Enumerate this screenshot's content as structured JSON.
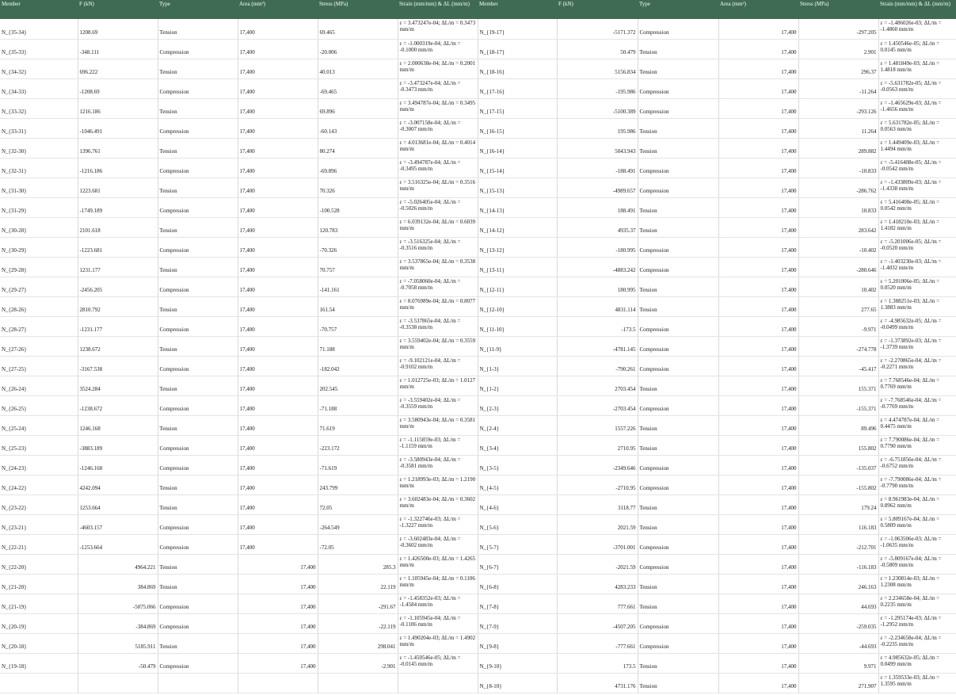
{
  "headers": [
    "Member",
    "F (kN)",
    "Type",
    "Area (mm²)",
    "Stress (MPa)",
    "Strain (mm/mm) & ΔL (mm/m)",
    "Member",
    "F (kN)",
    "Type",
    "Area (mm²)",
    "Stress (MPa)",
    "Strain (mm/mm) & ΔL (mm/m)"
  ],
  "rows": [
    {
      "left": [
        "N_{35-34}",
        "1208.69",
        "Tension",
        "17,400",
        "69.465",
        "ε = 3.473247e-04; ΔL/m = 0.3473 mm/m"
      ],
      "right": [
        "N_{19-17}",
        "-5171.372",
        "Compression",
        "17,400",
        "-297.205",
        "ε = -1.486026e-03; ΔL/m = -1.4860 mm/m"
      ]
    },
    {
      "left": [
        "N_{35-33}",
        "-348.111",
        "Compression",
        "17,400",
        "-20.006",
        "ε = -1.000319e-04; ΔL/m = -0.1000 mm/m"
      ],
      "right": [
        "N_{18-17}",
        "50.479",
        "Tension",
        "17,400",
        "2.901",
        "ε = 1.450546e-05; ΔL/m = 0.0145 mm/m"
      ]
    },
    {
      "left": [
        "N_{34-32}",
        "696.222",
        "Tension",
        "17,400",
        "40.013",
        "ε = 2.000638e-04; ΔL/m = 0.2001 mm/m"
      ],
      "right": [
        "N_{18-16}",
        "5156.834",
        "Tension",
        "17,400",
        "296.37",
        "ε = 1.481849e-03; ΔL/m = 1.4818 mm/m"
      ]
    },
    {
      "left": [
        "N_{34-33}",
        "-1208.69",
        "Compression",
        "17,400",
        "-69.465",
        "ε = -3.473247e-04; ΔL/m = -0.3473 mm/m"
      ],
      "right": [
        "N_{17-16}",
        "-195.986",
        "Compression",
        "17,400",
        "-11.264",
        "ε = -5.631782e-05; ΔL/m = -0.0563 mm/m"
      ]
    },
    {
      "left": [
        "N_{33-32}",
        "1216.186",
        "Tension",
        "17,400",
        "69.896",
        "ε = 3.494787e-04; ΔL/m = 0.3495 mm/m"
      ],
      "right": [
        "N_{17-15}",
        "-5100.389",
        "Compression",
        "17,400",
        "-293.126",
        "ε = -1.465629e-03; ΔL/m = -1.4656 mm/m"
      ]
    },
    {
      "left": [
        "N_{33-31}",
        "-1046.491",
        "Compression",
        "17,400",
        "-60.143",
        "ε = -3.007158e-04; ΔL/m = -0.3007 mm/m"
      ],
      "right": [
        "N_{16-15}",
        "195.986",
        "Tension",
        "17,400",
        "11.264",
        "ε = 5.631782e-05; ΔL/m = 0.0563 mm/m"
      ]
    },
    {
      "left": [
        "N_{32-30}",
        "1396.761",
        "Tension",
        "17,400",
        "80.274",
        "ε = 4.013681e-04; ΔL/m = 0.4014 mm/m"
      ],
      "right": [
        "N_{16-14}",
        "5043.943",
        "Tension",
        "17,400",
        "289.882",
        "ε = 1.449409e-03; ΔL/m = 1.4494 mm/m"
      ]
    },
    {
      "left": [
        "N_{32-31}",
        "-1216.186",
        "Compression",
        "17,400",
        "-69.896",
        "ε = -3.494787e-04; ΔL/m = -0.3495 mm/m"
      ],
      "right": [
        "N_{15-14}",
        "-188.491",
        "Compression",
        "17,400",
        "-10.833",
        "ε = -5.416408e-05; ΔL/m = -0.0542 mm/m"
      ]
    },
    {
      "left": [
        "N_{31-30}",
        "1223.681",
        "Tension",
        "17,400",
        "70.326",
        "ε = 3.516325e-04; ΔL/m = 0.3516 mm/m"
      ],
      "right": [
        "N_{15-13}",
        "-4989.657",
        "Compression",
        "17,400",
        "-286.762",
        "ε = -1.433809e-03; ΔL/m = -1.4338 mm/m"
      ]
    },
    {
      "left": [
        "N_{31-29}",
        "-1749.189",
        "Compression",
        "17,400",
        "-100.528",
        "ε = -5.026405e-04; ΔL/m = -0.5026 mm/m"
      ],
      "right": [
        "N_{14-13}",
        "188.491",
        "Tension",
        "17,400",
        "10.833",
        "ε = 5.416408e-05; ΔL/m = 0.0542 mm/m"
      ]
    },
    {
      "left": [
        "N_{30-28}",
        "2101.618",
        "Tension",
        "17,400",
        "120.783",
        "ε = 6.039132e-04; ΔL/m = 0.6039 mm/m"
      ],
      "right": [
        "N_{14-12}",
        "4935.37",
        "Tension",
        "17,400",
        "283.642",
        "ε = 1.418210e-03; ΔL/m = 1.4182 mm/m"
      ]
    },
    {
      "left": [
        "N_{30-29}",
        "-1223.681",
        "Compression",
        "17,400",
        "-70.326",
        "ε = -3.516325e-04; ΔL/m = -0.3516 mm/m"
      ],
      "right": [
        "N_{13-12}",
        "-180.995",
        "Compression",
        "17,400",
        "-10.402",
        "ε = -5.201006e-05; ΔL/m = -0.0520 mm/m"
      ]
    },
    {
      "left": [
        "N_{29-28}",
        "1231.177",
        "Tension",
        "17,400",
        "70.757",
        "ε = 3.537865e-04; ΔL/m = 0.3538 mm/m"
      ],
      "right": [
        "N_{13-11}",
        "-4883.242",
        "Compression",
        "17,400",
        "-280.646",
        "ε = -1.403230e-03; ΔL/m = -1.4032 mm/m"
      ]
    },
    {
      "left": [
        "N_{29-27}",
        "-2456.205",
        "Compression",
        "17,400",
        "-141.161",
        "ε = -7.058060e-04; ΔL/m = -0.7058 mm/m"
      ],
      "right": [
        "N_{12-11}",
        "180.995",
        "Tension",
        "17,400",
        "10.402",
        "ε = 5.201006e-05; ΔL/m = 0.0520 mm/m"
      ]
    },
    {
      "left": [
        "N_{28-26}",
        "2810.792",
        "Tension",
        "17,400",
        "161.54",
        "ε = 8.076989e-04; ΔL/m = 0.8077 mm/m"
      ],
      "right": [
        "N_{12-10}",
        "4831.114",
        "Tension",
        "17,400",
        "277.65",
        "ε = 1.388251e-03; ΔL/m = 1.3883 mm/m"
      ]
    },
    {
      "left": [
        "N_{28-27}",
        "-1231.177",
        "Compression",
        "17,400",
        "-70.757",
        "ε = -3.537865e-04; ΔL/m = -0.3538 mm/m"
      ],
      "right": [
        "N_{11-10}",
        "-173.5",
        "Compression",
        "17,400",
        "-9.971",
        "ε = -4.985632e-05; ΔL/m = -0.0499 mm/m"
      ]
    },
    {
      "left": [
        "N_{27-26}",
        "1238.672",
        "Tension",
        "17,400",
        "71.188",
        "ε = 3.559402e-04; ΔL/m = 0.3559 mm/m"
      ],
      "right": [
        "N_{11-9}",
        "-4781.145",
        "Compression",
        "17,400",
        "-274.778",
        "ε = -1.373892e-03; ΔL/m = -1.3739 mm/m"
      ]
    },
    {
      "left": [
        "N_{27-25}",
        "-3167.538",
        "Compression",
        "17,400",
        "-182.042",
        "ε = -9.102121e-04; ΔL/m = -0.9102 mm/m"
      ],
      "right": [
        "N_{1-3}",
        "-790.261",
        "Compression",
        "17,400",
        "-45.417",
        "ε = -2.270865e-04; ΔL/m = -0.2271 mm/m"
      ]
    },
    {
      "left": [
        "N_{26-24}",
        "3524.284",
        "Tension",
        "17,400",
        "202.545",
        "ε = 1.012725e-03; ΔL/m = 1.0127 mm/m"
      ],
      "right": [
        "N_{1-2}",
        "2703.454",
        "Tension",
        "17,400",
        "155.371",
        "ε = 7.768546e-04; ΔL/m = 0.7769 mm/m"
      ]
    },
    {
      "left": [
        "N_{26-25}",
        "-1238.672",
        "Compression",
        "17,400",
        "-71.188",
        "ε = -3.559402e-04; ΔL/m = -0.3559 mm/m"
      ],
      "right": [
        "N_{2-3}",
        "-2703.454",
        "Compression",
        "17,400",
        "-155.371",
        "ε = -7.768546e-04; ΔL/m = -0.7769 mm/m"
      ]
    },
    {
      "left": [
        "N_{25-24}",
        "1246.168",
        "Tension",
        "17,400",
        "71.619",
        "ε = 3.580943e-04; ΔL/m = 0.3581 mm/m"
      ],
      "right": [
        "N_{2-4}",
        "1557.226",
        "Tension",
        "17,400",
        "89.496",
        "ε = 4.474787e-04; ΔL/m = 0.4475 mm/m"
      ]
    },
    {
      "left": [
        "N_{25-23}",
        "-3883.189",
        "Compression",
        "17,400",
        "-223.172",
        "ε = -1.115859e-03; ΔL/m = -1.1159 mm/m"
      ],
      "right": [
        "N_{3-4}",
        "2710.95",
        "Tension",
        "17,400",
        "155.802",
        "ε = 7.790086e-04; ΔL/m = 0.7790 mm/m"
      ]
    },
    {
      "left": [
        "N_{24-23}",
        "-1246.168",
        "Compression",
        "17,400",
        "-71.619",
        "ε = -3.580943e-04; ΔL/m = -0.3581 mm/m"
      ],
      "right": [
        "N_{3-5}",
        "-2349.646",
        "Compression",
        "17,400",
        "-135.037",
        "ε = -6.751856e-04; ΔL/m = -0.6752 mm/m"
      ]
    },
    {
      "left": [
        "N_{24-22}",
        "4242.094",
        "Tension",
        "17,400",
        "243.799",
        "ε = 1.218993e-03; ΔL/m = 1.2190 mm/m"
      ],
      "right": [
        "N_{4-5}",
        "-2710.95",
        "Compression",
        "17,400",
        "-155.802",
        "ε = -7.790086e-04; ΔL/m = -0.7790 mm/m"
      ]
    },
    {
      "left": [
        "N_{23-22}",
        "1253.664",
        "Tension",
        "17,400",
        "72.05",
        "ε = 3.602483e-04; ΔL/m = 0.3602 mm/m"
      ],
      "right": [
        "N_{4-6}",
        "3118.77",
        "Tension",
        "17,400",
        "179.24",
        "ε = 8.961983e-04; ΔL/m = 0.8962 mm/m"
      ]
    },
    {
      "left": [
        "N_{23-21}",
        "-4603.157",
        "Compression",
        "17,400",
        "-264.549",
        "ε = -1.322746e-03; ΔL/m = -1.3227 mm/m"
      ],
      "right": [
        "N_{5-6}",
        "2021.59",
        "Tension",
        "17,400",
        "116.183",
        "ε = 5.809167e-04; ΔL/m = 0.5809 mm/m"
      ]
    },
    {
      "left": [
        "N_{22-21}",
        "-1253.664",
        "Compression",
        "17,400",
        "-72.05",
        "ε = -3.602483e-04; ΔL/m = -0.3602 mm/m"
      ],
      "right": [
        "N_{5-7}",
        "-3701.001",
        "Compression",
        "17,400",
        "-212.701",
        "ε = -1.063506e-03; ΔL/m = -1.0635 mm/m"
      ]
    },
    {
      "left": [
        "N_{22-20}",
        "4964.221",
        "Tension",
        "17,400",
        "285.3",
        "ε = 1.426500e-03; ΔL/m = 1.4265 mm/m"
      ],
      "right": [
        "N_{6-7}",
        "-2021.59",
        "Compression",
        "17,400",
        "-116.183",
        "ε = -5.809167e-04; ΔL/m = -0.5809 mm/m"
      ]
    },
    {
      "left": [
        "N_{21-20}",
        "384.869",
        "Tension",
        "17,400",
        "22.119",
        "ε = 1.105945e-04; ΔL/m = 0.1106 mm/m"
      ],
      "right": [
        "N_{6-8}",
        "4283.233",
        "Tension",
        "17,400",
        "246.163",
        "ε = 1.230814e-03; ΔL/m = 1.2308 mm/m"
      ]
    },
    {
      "left": [
        "N_{21-19}",
        "-5075.066",
        "Compression",
        "17,400",
        "-291.67",
        "ε = -1.458352e-03; ΔL/m = -1.4584 mm/m"
      ],
      "right": [
        "N_{7-8}",
        "777.661",
        "Tension",
        "17,400",
        "44.693",
        "ε = 2.234658e-04; ΔL/m = 0.2235 mm/m"
      ]
    },
    {
      "left": [
        "N_{20-19}",
        "-384.869",
        "Compression",
        "17,400",
        "-22.119",
        "ε = -1.105945e-04; ΔL/m = -0.1106 mm/m"
      ],
      "right": [
        "N_{7-9}",
        "-4507.205",
        "Compression",
        "17,400",
        "-259.035",
        "ε = -1.295174e-03; ΔL/m = -1.2952 mm/m"
      ]
    },
    {
      "left": [
        "N_{20-18}",
        "5185.911",
        "Tension",
        "17,400",
        "298.041",
        "ε = 1.490204e-03; ΔL/m = 1.4902 mm/m"
      ],
      "right": [
        "N_{9-8}",
        "-777.661",
        "Compression",
        "17,400",
        "-44.693",
        "ε = -2.234658e-04; ΔL/m = -0.2235 mm/m"
      ]
    },
    {
      "left": [
        "N_{19-18}",
        "-50.479",
        "Compression",
        "17,400",
        "-2.901",
        "ε = -1.450546e-05; ΔL/m = -0.0145 mm/m"
      ],
      "right": [
        "N_{9-10}",
        "173.5",
        "Tension",
        "17,400",
        "9.971",
        "ε = 4.985632e-05; ΔL/m = 0.0499 mm/m"
      ]
    },
    {
      "left": [
        "",
        "",
        "",
        "",
        "",
        ""
      ],
      "right": [
        "N_{8-10}",
        "4731.176",
        "Tension",
        "17,400",
        "271.907",
        "ε = 1.359533e-03; ΔL/m = 1.3595 mm/m"
      ]
    }
  ]
}
